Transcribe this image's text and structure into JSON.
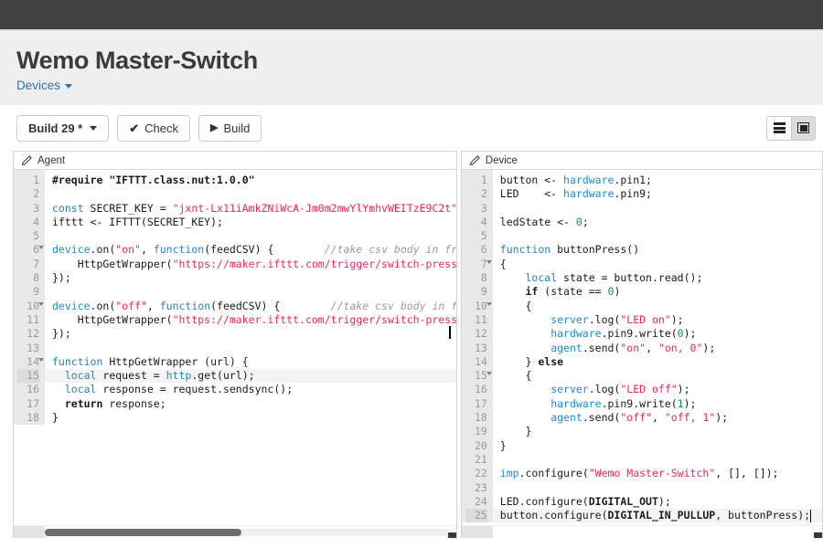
{
  "header": {
    "bar_color": "#414141",
    "title": "Wemo Master-Switch",
    "breadcrumb": "Devices",
    "breadcrumb_color": "#2b72b8"
  },
  "toolbar": {
    "build_label": "Build 29 *",
    "check_label": "Check",
    "check_icon": "check-icon",
    "build_run_label": "Build",
    "build_run_icon": "play-icon",
    "layout_rows_icon": "layout-rows-icon",
    "layout_cols_icon": "layout-columns-icon",
    "active_layout": "columns"
  },
  "panels": [
    {
      "id": "agent",
      "tab_label": "Agent",
      "tab_icon": "pencil-icon",
      "active_line": 15,
      "fold_lines": [
        6,
        10,
        14
      ],
      "scrollbar": {
        "thumb_percent": 48
      },
      "lines": [
        {
          "n": 1,
          "tokens": [
            {
              "t": "#require ",
              "c": "kw"
            },
            {
              "t": "\"IFTTT.class.nut:1.0.0\"",
              "c": "bold"
            }
          ]
        },
        {
          "n": 2,
          "tokens": []
        },
        {
          "n": 3,
          "tokens": [
            {
              "t": "const",
              "c": "blue"
            },
            {
              "t": " SECRET_KEY = ",
              "c": ""
            },
            {
              "t": "\"jxnt-Lx11iAmkZNiWcA-Jm0m2mwYlYmhvWEITzE9C2t\"",
              "c": "str"
            },
            {
              "t": ";",
              "c": ""
            }
          ]
        },
        {
          "n": 4,
          "tokens": [
            {
              "t": "ifttt <- IFTTT(SECRET_KEY);",
              "c": ""
            }
          ]
        },
        {
          "n": 5,
          "tokens": []
        },
        {
          "n": 6,
          "tokens": [
            {
              "t": "device",
              "c": "blu2"
            },
            {
              "t": ".on(",
              "c": ""
            },
            {
              "t": "\"on\"",
              "c": "str"
            },
            {
              "t": ", ",
              "c": ""
            },
            {
              "t": "function",
              "c": "blue"
            },
            {
              "t": "(feedCSV) {",
              "c": ""
            },
            {
              "t": "        //take csv body in from",
              "c": "com"
            }
          ]
        },
        {
          "n": 7,
          "tokens": [
            {
              "t": "    HttpGetWrapper(",
              "c": ""
            },
            {
              "t": "\"https://maker.ifttt.com/trigger/switch-presse",
              "c": "str"
            }
          ]
        },
        {
          "n": 8,
          "tokens": [
            {
              "t": "});",
              "c": ""
            }
          ]
        },
        {
          "n": 9,
          "tokens": []
        },
        {
          "n": 10,
          "tokens": [
            {
              "t": "device",
              "c": "blu2"
            },
            {
              "t": ".on(",
              "c": ""
            },
            {
              "t": "\"off\"",
              "c": "str"
            },
            {
              "t": ", ",
              "c": ""
            },
            {
              "t": "function",
              "c": "blue"
            },
            {
              "t": "(feedCSV) {",
              "c": ""
            },
            {
              "t": "        //take csv body in fro",
              "c": "com"
            }
          ]
        },
        {
          "n": 11,
          "tokens": [
            {
              "t": "    HttpGetWrapper(",
              "c": ""
            },
            {
              "t": "\"https://maker.ifttt.com/trigger/switch-presse",
              "c": "str"
            }
          ]
        },
        {
          "n": 12,
          "tokens": [
            {
              "t": "});",
              "c": ""
            }
          ]
        },
        {
          "n": 13,
          "tokens": []
        },
        {
          "n": 14,
          "tokens": [
            {
              "t": "function",
              "c": "blue"
            },
            {
              "t": " HttpGetWrapper (url) {",
              "c": ""
            }
          ]
        },
        {
          "n": 15,
          "tokens": [
            {
              "t": "  ",
              "c": ""
            },
            {
              "t": "local",
              "c": "blue"
            },
            {
              "t": " request = ",
              "c": ""
            },
            {
              "t": "http",
              "c": "blu2"
            },
            {
              "t": ".get(url);",
              "c": ""
            }
          ]
        },
        {
          "n": 16,
          "tokens": [
            {
              "t": "  ",
              "c": ""
            },
            {
              "t": "local",
              "c": "blue"
            },
            {
              "t": " response = request.sendsync();",
              "c": ""
            }
          ]
        },
        {
          "n": 17,
          "tokens": [
            {
              "t": "  ",
              "c": ""
            },
            {
              "t": "return",
              "c": "kw"
            },
            {
              "t": " response;",
              "c": ""
            }
          ]
        },
        {
          "n": 18,
          "tokens": [
            {
              "t": "}",
              "c": ""
            }
          ]
        }
      ]
    },
    {
      "id": "device",
      "tab_label": "Device",
      "tab_icon": "pencil-icon",
      "active_line": 25,
      "fold_lines": [
        7,
        10,
        15
      ],
      "lines": [
        {
          "n": 1,
          "tokens": [
            {
              "t": "button <- ",
              "c": ""
            },
            {
              "t": "hardware",
              "c": "blu2"
            },
            {
              "t": ".pin1;",
              "c": ""
            }
          ]
        },
        {
          "n": 2,
          "tokens": [
            {
              "t": "LED    <- ",
              "c": ""
            },
            {
              "t": "hardware",
              "c": "blu2"
            },
            {
              "t": ".pin9;",
              "c": ""
            }
          ]
        },
        {
          "n": 3,
          "tokens": []
        },
        {
          "n": 4,
          "tokens": [
            {
              "t": "ledState <- ",
              "c": ""
            },
            {
              "t": "0",
              "c": "num"
            },
            {
              "t": ";",
              "c": ""
            }
          ]
        },
        {
          "n": 5,
          "tokens": []
        },
        {
          "n": 6,
          "tokens": [
            {
              "t": "function",
              "c": "blue"
            },
            {
              "t": " buttonPress()",
              "c": ""
            }
          ]
        },
        {
          "n": 7,
          "tokens": [
            {
              "t": "{",
              "c": ""
            }
          ]
        },
        {
          "n": 8,
          "tokens": [
            {
              "t": "    ",
              "c": ""
            },
            {
              "t": "local",
              "c": "blue"
            },
            {
              "t": " state = button.read();",
              "c": ""
            }
          ]
        },
        {
          "n": 9,
          "tokens": [
            {
              "t": "    ",
              "c": ""
            },
            {
              "t": "if",
              "c": "kw"
            },
            {
              "t": " (state == ",
              "c": ""
            },
            {
              "t": "0",
              "c": "num"
            },
            {
              "t": ")",
              "c": ""
            }
          ]
        },
        {
          "n": 10,
          "tokens": [
            {
              "t": "    {",
              "c": ""
            }
          ]
        },
        {
          "n": 11,
          "tokens": [
            {
              "t": "        ",
              "c": ""
            },
            {
              "t": "server",
              "c": "blu2"
            },
            {
              "t": ".log(",
              "c": ""
            },
            {
              "t": "\"LED on\"",
              "c": "str"
            },
            {
              "t": ");",
              "c": ""
            }
          ]
        },
        {
          "n": 12,
          "tokens": [
            {
              "t": "        ",
              "c": ""
            },
            {
              "t": "hardware",
              "c": "blu2"
            },
            {
              "t": ".pin9.write(",
              "c": ""
            },
            {
              "t": "0",
              "c": "num"
            },
            {
              "t": ");",
              "c": ""
            }
          ]
        },
        {
          "n": 13,
          "tokens": [
            {
              "t": "        ",
              "c": ""
            },
            {
              "t": "agent",
              "c": "blu2"
            },
            {
              "t": ".send(",
              "c": ""
            },
            {
              "t": "\"on\"",
              "c": "str"
            },
            {
              "t": ", ",
              "c": ""
            },
            {
              "t": "\"on, 0\"",
              "c": "str"
            },
            {
              "t": ");",
              "c": ""
            }
          ]
        },
        {
          "n": 14,
          "tokens": [
            {
              "t": "    } ",
              "c": ""
            },
            {
              "t": "else",
              "c": "kw"
            }
          ]
        },
        {
          "n": 15,
          "tokens": [
            {
              "t": "    {",
              "c": ""
            }
          ]
        },
        {
          "n": 16,
          "tokens": [
            {
              "t": "        ",
              "c": ""
            },
            {
              "t": "server",
              "c": "blu2"
            },
            {
              "t": ".log(",
              "c": ""
            },
            {
              "t": "\"LED off\"",
              "c": "str"
            },
            {
              "t": ");",
              "c": ""
            }
          ]
        },
        {
          "n": 17,
          "tokens": [
            {
              "t": "        ",
              "c": ""
            },
            {
              "t": "hardware",
              "c": "blu2"
            },
            {
              "t": ".pin9.write(",
              "c": ""
            },
            {
              "t": "1",
              "c": "num"
            },
            {
              "t": ");",
              "c": ""
            }
          ]
        },
        {
          "n": 18,
          "tokens": [
            {
              "t": "        ",
              "c": ""
            },
            {
              "t": "agent",
              "c": "blu2"
            },
            {
              "t": ".send(",
              "c": ""
            },
            {
              "t": "\"off\"",
              "c": "str"
            },
            {
              "t": ", ",
              "c": ""
            },
            {
              "t": "\"off, 1\"",
              "c": "str"
            },
            {
              "t": ");",
              "c": ""
            }
          ]
        },
        {
          "n": 19,
          "tokens": [
            {
              "t": "    }",
              "c": ""
            }
          ]
        },
        {
          "n": 20,
          "tokens": [
            {
              "t": "}",
              "c": ""
            }
          ]
        },
        {
          "n": 21,
          "tokens": []
        },
        {
          "n": 22,
          "tokens": [
            {
              "t": "imp",
              "c": "blu2"
            },
            {
              "t": ".configure(",
              "c": ""
            },
            {
              "t": "\"Wemo Master-Switch\"",
              "c": "str"
            },
            {
              "t": ", [], []);",
              "c": ""
            }
          ]
        },
        {
          "n": 23,
          "tokens": []
        },
        {
          "n": 24,
          "tokens": [
            {
              "t": "LED.configure(",
              "c": ""
            },
            {
              "t": "DIGITAL_OUT",
              "c": "kw"
            },
            {
              "t": ");",
              "c": ""
            }
          ]
        },
        {
          "n": 25,
          "tokens": [
            {
              "t": "button.configure(",
              "c": ""
            },
            {
              "t": "DIGITAL_IN_PULLUP",
              "c": "kw"
            },
            {
              "t": ", buttonPress);",
              "c": ""
            }
          ]
        }
      ]
    }
  ]
}
